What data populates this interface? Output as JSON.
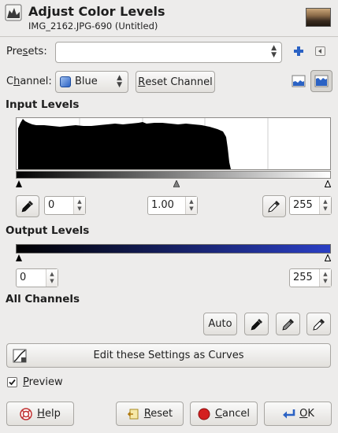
{
  "header": {
    "title": "Adjust Color Levels",
    "subtitle": "IMG_2162.JPG-690 (Untitled)",
    "icon": "levels-tool-icon"
  },
  "presets": {
    "label_pre": "Pre",
    "label_u": "s",
    "label_post": "ets:",
    "value": ""
  },
  "channel": {
    "label_pre": "C",
    "label_u": "h",
    "label_post": "annel:",
    "selected": "Blue",
    "reset_pre": "",
    "reset_u": "R",
    "reset_post": "eset Channel"
  },
  "input_levels": {
    "title": "Input Levels",
    "low": "0",
    "gamma": "1.00",
    "high": "255",
    "gamma_position": 0.51
  },
  "output_levels": {
    "title": "Output Levels",
    "low": "0",
    "high": "255",
    "gradient_end_color": "#2b3fc4"
  },
  "all_channels": {
    "title": "All Channels",
    "auto_label": "Auto"
  },
  "curves_button": {
    "label": "Edit these Settings as Curves"
  },
  "preview": {
    "label_pre": "",
    "label_u": "P",
    "label_post": "review",
    "checked": true
  },
  "actions": {
    "help_pre": "",
    "help_u": "H",
    "help_post": "elp",
    "reset_pre": "",
    "reset_u": "R",
    "reset_post": "eset",
    "cancel_pre": "",
    "cancel_u": "C",
    "cancel_post": "ancel",
    "ok_pre": "",
    "ok_u": "O",
    "ok_post": "K"
  },
  "colors": {
    "accent_blue": "#2b62c4",
    "cancel_red": "#d42020"
  }
}
